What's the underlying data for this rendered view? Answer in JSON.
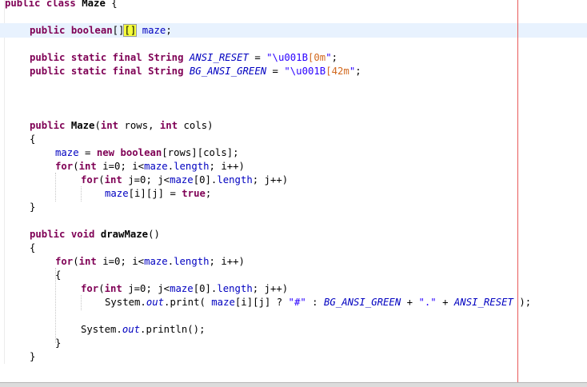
{
  "code": {
    "line_0": {
      "t1": "public class ",
      "t2": "Maze",
      "t3": " {"
    },
    "line_1": {
      "t1": "public boolean",
      "t2": "[]",
      "t3": "[]",
      "t4": " ",
      "t5": "maze",
      "t6": ";"
    },
    "line_2": {
      "t1": "public static final String ",
      "t2": "ANSI_RESET",
      "t3": " = ",
      "t4": "\"\\u001B",
      "t5": "[0m",
      "t6": "\"",
      "t7": ";"
    },
    "line_3": {
      "t1": "public static final String ",
      "t2": "BG_ANSI_GREEN",
      "t3": " = ",
      "t4": "\"\\u001B",
      "t5": "[42m",
      "t6": "\"",
      "t7": ";"
    },
    "line_4": {
      "t1": "public ",
      "t2": "Maze",
      "t3": "(",
      "t4": "int",
      "t5": " rows, ",
      "t6": "int",
      "t7": " cols)"
    },
    "line_5": {
      "t1": "{"
    },
    "line_6": {
      "t1": "maze",
      "t2": " = ",
      "t3": "new boolean",
      "t4": "[rows][cols];"
    },
    "line_7": {
      "t1": "for",
      "t2": "(",
      "t3": "int",
      "t4": " i=0; i<",
      "t5": "maze",
      "t6": ".",
      "t7": "length",
      "t8": "; i++)"
    },
    "line_8": {
      "t1": "for",
      "t2": "(",
      "t3": "int",
      "t4": " j=0; j<",
      "t5": "maze",
      "t6": "[0].",
      "t7": "length",
      "t8": "; j++)"
    },
    "line_9": {
      "t1": "maze",
      "t2": "[i][j] = ",
      "t3": "true",
      "t4": ";"
    },
    "line_10": {
      "t1": "}"
    },
    "line_11": {
      "t1": "public void ",
      "t2": "drawMaze",
      "t3": "()"
    },
    "line_12": {
      "t1": "{"
    },
    "line_13": {
      "t1": "for",
      "t2": "(",
      "t3": "int",
      "t4": " i=0; i<",
      "t5": "maze",
      "t6": ".",
      "t7": "length",
      "t8": "; i++)"
    },
    "line_14": {
      "t1": "{"
    },
    "line_15": {
      "t1": "for",
      "t2": "(",
      "t3": "int",
      "t4": " j=0; j<",
      "t5": "maze",
      "t6": "[0].",
      "t7": "length",
      "t8": "; j++)"
    },
    "line_16": {
      "t1": "System.",
      "t2": "out",
      "t3": ".print( ",
      "t4": "maze",
      "t5": "[i][j] ? ",
      "t6": "\"#\"",
      "t7": " : ",
      "t8": "BG_ANSI_GREEN",
      "t9": " + ",
      "t10": "\".\"",
      "t11": " + ",
      "t12": "ANSI_RESET",
      "t13": " );"
    },
    "line_17": {
      "t1": "System.",
      "t2": "out",
      "t3": ".println();"
    },
    "line_18": {
      "t1": "}"
    },
    "line_19": {
      "t1": "}"
    }
  },
  "colors": {
    "keyword": "#7f0055",
    "field": "#0000c0",
    "string": "#2a00ff",
    "current_line": "#e8f2fe",
    "bracket_match": "#f6ff3a",
    "print_margin": "#e85a5a"
  }
}
